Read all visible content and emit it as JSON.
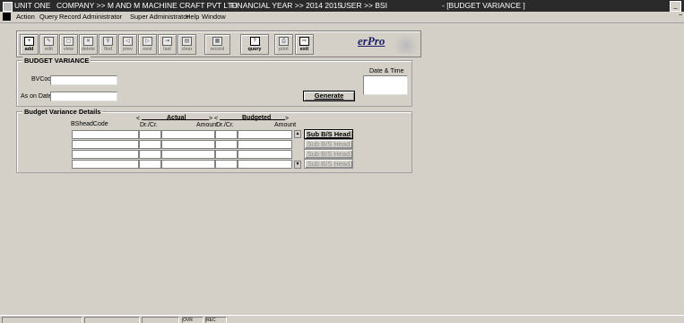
{
  "titlebar": {
    "unit": "UNIT ONE",
    "company": "COMPANY >> M AND M MACHINE CRAFT PVT LTD",
    "financial_year": "FINANCIAL YEAR >> 2014 2015",
    "user": "USER >> BSI",
    "window": "- [BUDGET VARIANCE ]"
  },
  "menu": [
    "Action",
    "Query",
    "Record",
    "Administrator",
    "Super Administrator",
    "Help",
    "Window"
  ],
  "toolbar": {
    "buttons": [
      {
        "label": "add",
        "icon": "add-icon",
        "enabled": true
      },
      {
        "label": "edit",
        "icon": "edit-icon",
        "enabled": false
      },
      {
        "label": "view",
        "icon": "view-icon",
        "enabled": false
      },
      {
        "label": "delete",
        "icon": "delete-icon",
        "enabled": false
      },
      {
        "label": "find",
        "icon": "find-icon",
        "enabled": false
      },
      {
        "label": "prev",
        "icon": "prev-icon",
        "enabled": false
      },
      {
        "label": "next",
        "icon": "next-icon",
        "enabled": false
      },
      {
        "label": "last",
        "icon": "last-icon",
        "enabled": false
      },
      {
        "label": "clear",
        "icon": "clear-icon",
        "enabled": false
      },
      {
        "label": "record",
        "icon": "record-icon",
        "enabled": false
      },
      {
        "label": "query",
        "icon": "query-icon",
        "enabled": true
      },
      {
        "label": "print",
        "icon": "print-icon",
        "enabled": false
      },
      {
        "label": "exit",
        "icon": "exit-icon",
        "enabled": true
      }
    ],
    "brand": "erPro"
  },
  "form": {
    "title": "BUDGET VARIANCE",
    "bv_code_label": "BVCode",
    "bv_code_value": "",
    "as_on_date_label": "As on Date",
    "as_on_date_value": "",
    "date_time_label": "Date & Time",
    "generate_label": "Generate"
  },
  "details": {
    "title": "Budget Variance Details",
    "col_bshead": "BSheadCode",
    "col_drcr": "Dr./Cr.",
    "col_amount": "Amount",
    "group_actual": "Actual",
    "group_budgeted": "Budgeted",
    "arrow_left": "<",
    "arrow_right": ">",
    "sub_head_label": "Sub B/S Head",
    "rows": [
      {
        "bshead": "",
        "act_drcr": "",
        "act_amount": "",
        "bud_drcr": "",
        "bud_amount": ""
      },
      {
        "bshead": "",
        "act_drcr": "",
        "act_amount": "",
        "bud_drcr": "",
        "bud_amount": ""
      },
      {
        "bshead": "",
        "act_drcr": "",
        "act_amount": "",
        "bud_drcr": "",
        "bud_amount": ""
      },
      {
        "bshead": "",
        "act_drcr": "",
        "act_amount": "",
        "bud_drcr": "",
        "bud_amount": ""
      }
    ]
  },
  "statusbar": {
    "ovr": "OVR",
    "rec": "REC"
  }
}
